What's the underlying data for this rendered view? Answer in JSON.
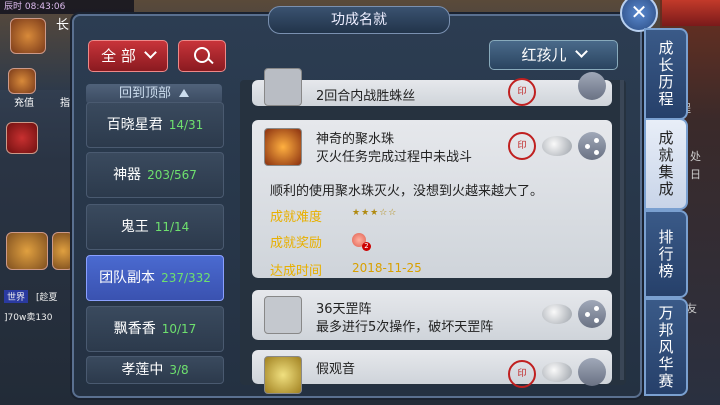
{
  "hud": {
    "time_prefix": "辰时",
    "clock": "08:43:06",
    "top_char": "长",
    "recharge": "充值",
    "pin": "指",
    "world_tag": "世界",
    "chat_name": "[趁夏",
    "chat_line": "]70w卖130",
    "right_label_1": "处",
    "right_label_2": "日",
    "right_label_3": "友",
    "right_label_4": "程"
  },
  "panel": {
    "title": "功成名就",
    "close_symbol": "✕",
    "filter_label": "全 部",
    "character_name": "红孩儿",
    "back_to_top": "回到顶部"
  },
  "categories": [
    {
      "name": "百晓星君",
      "count": "14/31"
    },
    {
      "name": "神器",
      "count": "203/567"
    },
    {
      "name": "鬼王",
      "count": "11/14"
    },
    {
      "name": "团队副本",
      "count": "237/332"
    },
    {
      "name": "飘香香",
      "count": "10/17"
    },
    {
      "name": "孝莲中",
      "count": "3/8"
    }
  ],
  "achievements": [
    {
      "name": "2回合内战胜蛛丝",
      "icon": "spider-web-icon"
    },
    {
      "name": "神奇的聚水珠",
      "desc": "灭火任务完成过程中未战斗",
      "detail": "顺利的使用聚水珠灭火，没想到火越来越大了。",
      "difficulty_label": "成就难度",
      "difficulty_stars": "★★★☆☆",
      "difficulty_value": 3,
      "reward_label": "成就奖励",
      "reward_count": "2",
      "date_label": "达成时间",
      "date": "2018-11-25",
      "icon": "fire-bowl-icon"
    },
    {
      "name": "36天罡阵",
      "desc": "最多进行5次操作，破坏天罡阵",
      "icon": "crossed-swords-icon"
    },
    {
      "name": "假观音",
      "icon": "dice-icon"
    }
  ],
  "tabs": [
    {
      "label": "成长历程",
      "active": false
    },
    {
      "label": "成就集成",
      "active": true
    },
    {
      "label": "排行榜",
      "active": false
    },
    {
      "label": "万邦风华赛",
      "active": false
    }
  ],
  "seal_text": "印",
  "colors": {
    "accent_red": "#c8343a",
    "count_green": "#6ee06e",
    "gold_label": "#e8b000",
    "active_category": "#4a6ad0"
  }
}
